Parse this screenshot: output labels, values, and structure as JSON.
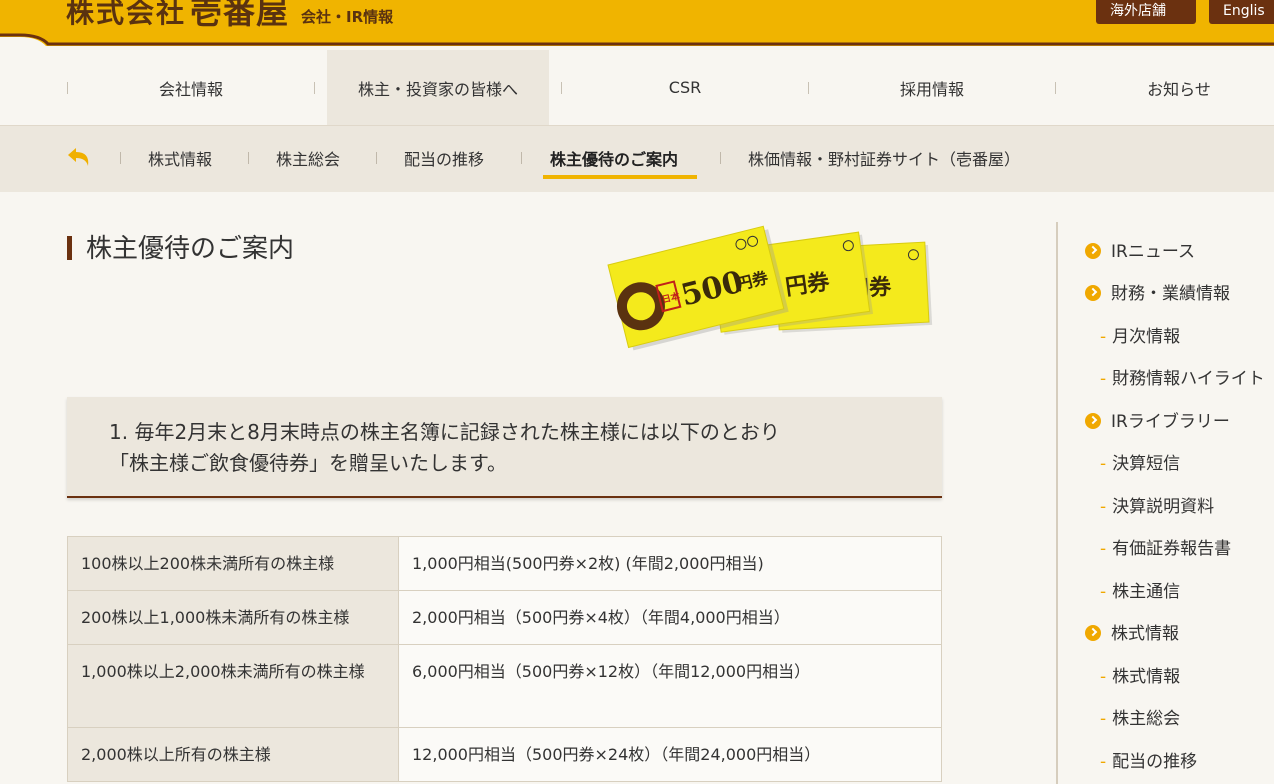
{
  "header": {
    "logo_main": "株式会社",
    "logo_brand": "壱番屋",
    "logo_sub": "会社・IR情報",
    "overseas_button": "海外店舗",
    "english_button": "Englis"
  },
  "nav": {
    "items": [
      {
        "label": "会社情報"
      },
      {
        "label": "株主・投資家の皆様へ"
      },
      {
        "label": "CSR"
      },
      {
        "label": "採用情報"
      },
      {
        "label": "お知らせ"
      }
    ]
  },
  "subnav": {
    "items": [
      {
        "label": "株式情報"
      },
      {
        "label": "株主総会"
      },
      {
        "label": "配当の推移"
      },
      {
        "label": "株主優待のご案内"
      },
      {
        "label": "株価情報・野村証券サイト（壱番屋）"
      }
    ]
  },
  "main": {
    "title": "株主優待のご案内",
    "ticket": {
      "amount": "500",
      "unit": "円券",
      "stamp": "日本"
    },
    "note_line1": "1.  毎年2月末と8月末時点の株主名簿に記録された株主様には以下のとおり",
    "note_line2": "「株主様ご飲食優待券」を贈呈いたします。",
    "table": [
      {
        "holding": "100株以上200株未満所有の株主様",
        "benefit": "1,000円相当(500円券×2枚)  (年間2,000円相当)"
      },
      {
        "holding": "200株以上1,000株未満所有の株主様",
        "benefit": "2,000円相当（500円券×4枚）（年間4,000円相当）"
      },
      {
        "holding": "1,000株以上2,000株未満所有の株主様",
        "benefit": "6,000円相当（500円券×12枚）（年間12,000円相当）"
      },
      {
        "holding": "2,000株以上所有の株主様",
        "benefit": "12,000円相当（500円券×24枚）（年間24,000円相当）"
      }
    ]
  },
  "sidebar": {
    "items": [
      {
        "label": "IRニュース"
      },
      {
        "label": "財務・業績情報"
      },
      {
        "label": "月次情報"
      },
      {
        "label": "財務情報ハイライト"
      },
      {
        "label": "IRライブラリー"
      },
      {
        "label": "決算短信"
      },
      {
        "label": "決算説明資料"
      },
      {
        "label": "有価証券報告書"
      },
      {
        "label": "株主通信"
      },
      {
        "label": "株式情報"
      },
      {
        "label": "株式情報"
      },
      {
        "label": "株主総会"
      },
      {
        "label": "配当の推移"
      }
    ]
  },
  "colors": {
    "brand_yellow": "#f0b400",
    "brand_brown": "#6b3110",
    "background": "#f8f6f1",
    "panel": "#ece7dd"
  }
}
